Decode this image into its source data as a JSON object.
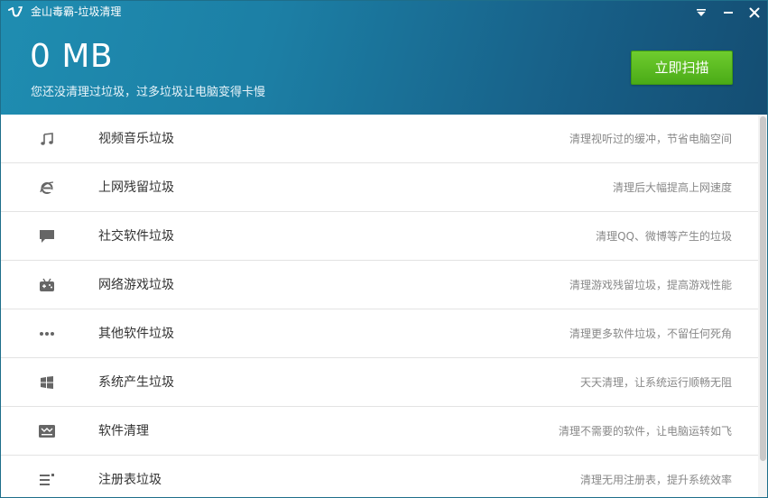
{
  "window": {
    "title": "金山毒霸-垃圾清理"
  },
  "summary": {
    "size": "0 MB",
    "status": "您还没清理过垃圾，过多垃圾让电脑变得卡慢",
    "scan_label": "立即扫描"
  },
  "colors": {
    "header_start": "#1f8db1",
    "header_end": "#144d72",
    "scan_button": "#5bbd22",
    "row_divider": "#e3e3e3"
  },
  "items": [
    {
      "icon": "music-note-icon",
      "title": "视频音乐垃圾",
      "desc": "清理视听过的缓冲，节省电脑空间"
    },
    {
      "icon": "browser-ie-icon",
      "title": "上网残留垃圾",
      "desc": "清理后大幅提高上网速度"
    },
    {
      "icon": "chat-bubble-icon",
      "title": "社交软件垃圾",
      "desc": "清理QQ、微博等产生的垃圾"
    },
    {
      "icon": "gamepad-icon",
      "title": "网络游戏垃圾",
      "desc": "清理游戏残留垃圾，提高游戏性能"
    },
    {
      "icon": "more-dots-icon",
      "title": "其他软件垃圾",
      "desc": "清理更多软件垃圾，不留任何死角"
    },
    {
      "icon": "windows-icon",
      "title": "系统产生垃圾",
      "desc": "天天清理，让系统运行顺畅无阻"
    },
    {
      "icon": "software-box-icon",
      "title": "软件清理",
      "desc": "清理不需要的软件，让电脑运转如飞"
    },
    {
      "icon": "registry-icon",
      "title": "注册表垃圾",
      "desc": "清理无用注册表，提升系统效率"
    }
  ]
}
